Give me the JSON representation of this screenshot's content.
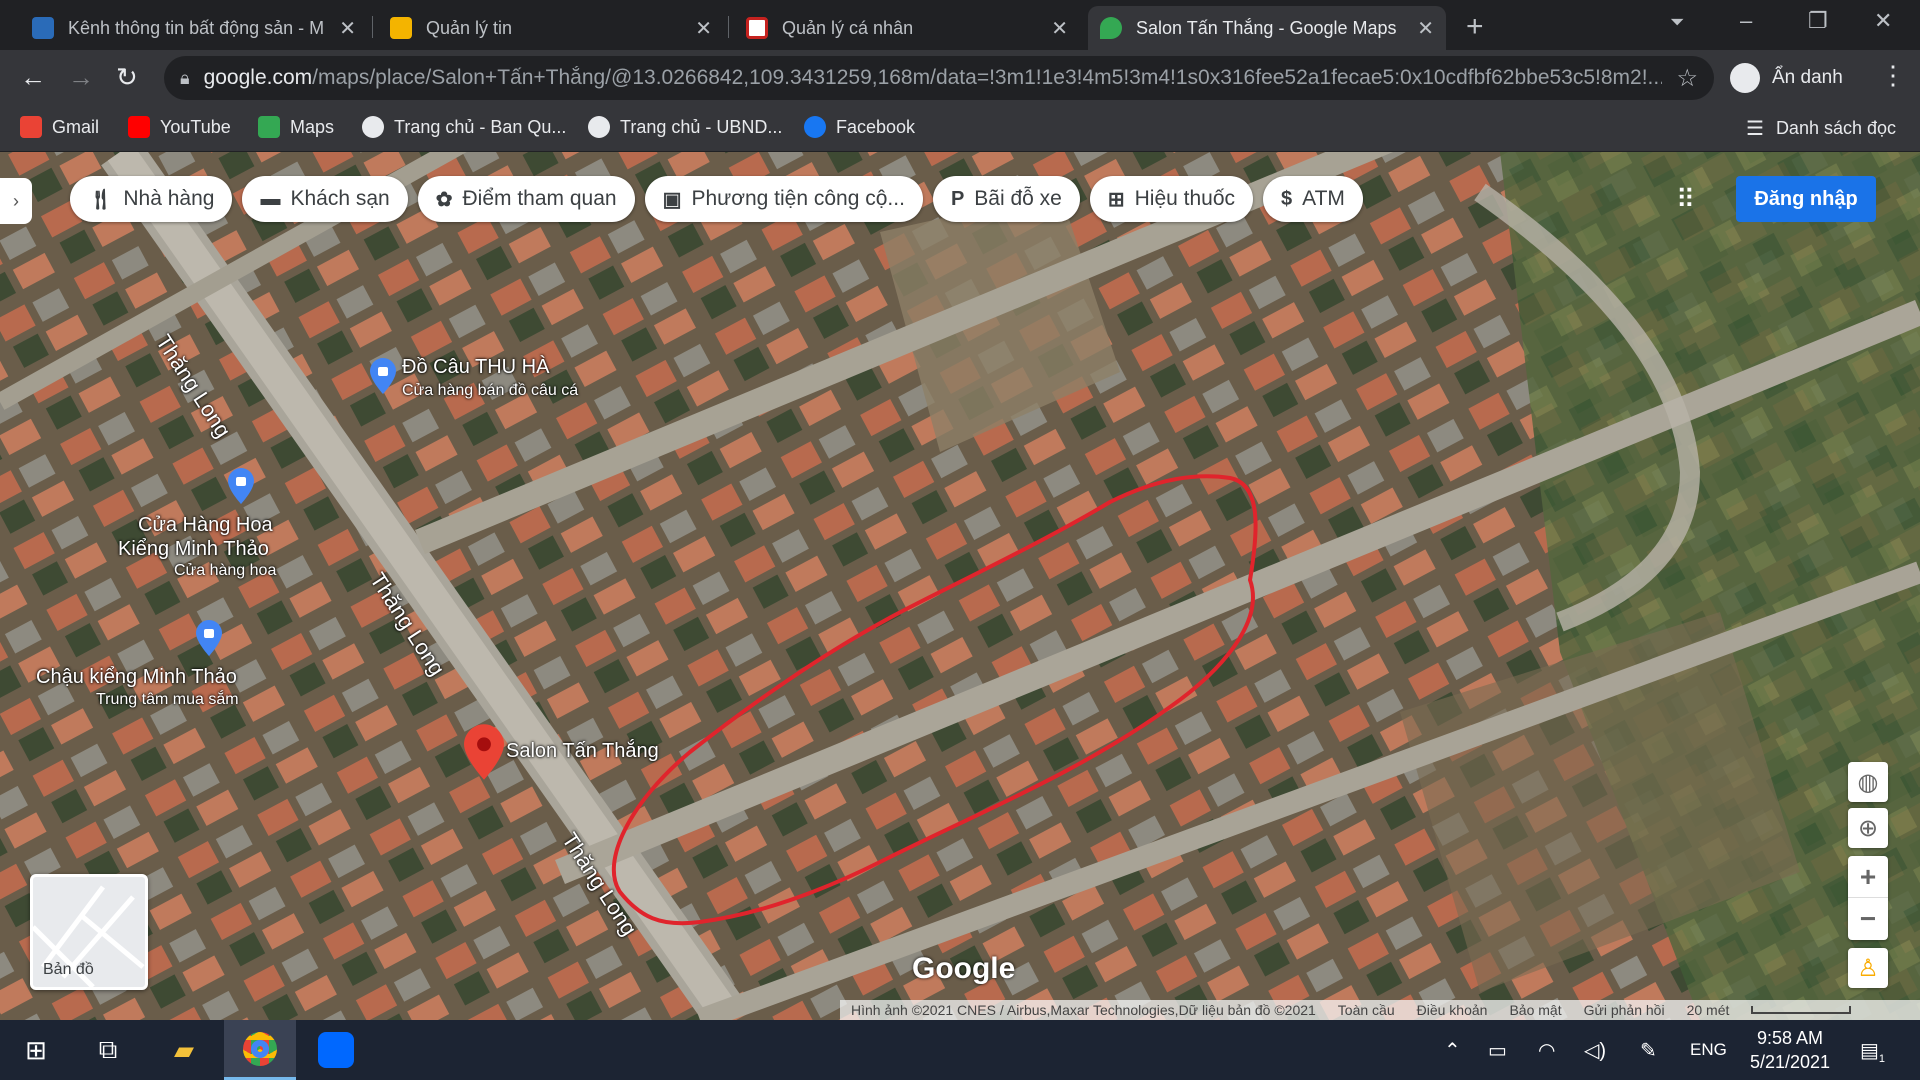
{
  "browser": {
    "tabs": [
      {
        "title": "Kênh thông tin bất động sản - M",
        "favicon": "house-icon",
        "active": false
      },
      {
        "title": "Quản lý tin",
        "favicon": "news-icon",
        "active": false
      },
      {
        "title": "Quản lý cá nhân",
        "favicon": "home-icon",
        "active": false
      },
      {
        "title": "Salon Tấn Thắng - Google Maps",
        "favicon": "maps-pin-icon",
        "active": true
      }
    ],
    "url_host": "google.com",
    "url_path": "/maps/place/Salon+Tấn+Thắng/@13.0266842,109.3431259,168m/data=!3m1!1e3!4m5!3m4!1s0x316fee52a1fecae5:0x10cdfbf62bbe53c5!8m2!...",
    "incognito_label": "Ẩn danh",
    "bookmarks": [
      "Gmail",
      "YouTube",
      "Maps",
      "Trang chủ - Ban Qu...",
      "Trang chủ - UBND...",
      "Facebook"
    ],
    "reading_list": "Danh sách đọc"
  },
  "map": {
    "chips": [
      {
        "label": "Nhà hàng",
        "icon": "restaurant-icon"
      },
      {
        "label": "Khách sạn",
        "icon": "hotel-icon"
      },
      {
        "label": "Điểm tham quan",
        "icon": "attraction-icon"
      },
      {
        "label": "Phương tiện công cộ...",
        "icon": "transit-icon"
      },
      {
        "label": "Bãi đỗ xe",
        "icon": "parking-icon"
      },
      {
        "label": "Hiệu thuốc",
        "icon": "pharmacy-icon"
      },
      {
        "label": "ATM",
        "icon": "atm-icon"
      }
    ],
    "signin": "Đăng nhập",
    "places": [
      {
        "name": "Đồ Câu THU HÀ",
        "sub": "Cửa hàng bán đồ câu cá"
      },
      {
        "name": "Cửa Hàng Hoa Kiểng Minh Thảo",
        "name_l1": "Cửa Hàng Hoa",
        "name_l2": "Kiểng Minh Thảo",
        "sub": "Cửa hàng hoa"
      },
      {
        "name": "Chậu kiểng Minh Thảo",
        "sub": "Trung tâm mua sắm"
      },
      {
        "name": "Salon Tấn Thắng",
        "sub": ""
      }
    ],
    "road_name": "Thăng Long",
    "minimap_label": "Bản đồ",
    "logo": "Google",
    "attribution": "Hình ảnh ©2021 CNES / Airbus,Maxar Technologies,Dữ liệu bản đồ ©2021",
    "footer_links": [
      "Toàn cầu",
      "Điều khoản",
      "Bảo mật",
      "Gửi phản hồi"
    ],
    "scale_label": "20 mét",
    "highlight_color": "#e0242c"
  },
  "taskbar": {
    "language": "ENG",
    "time": "9:58 AM",
    "date": "5/21/2021",
    "notifications": "1"
  }
}
